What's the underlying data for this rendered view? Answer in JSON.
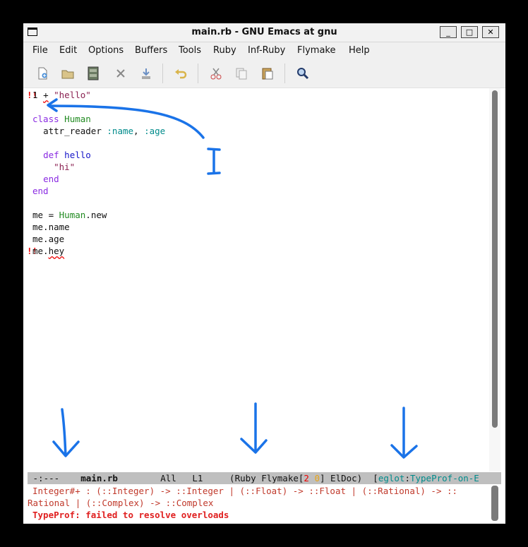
{
  "window": {
    "title": "main.rb - GNU Emacs at gnu",
    "minimize_label": "_",
    "maximize_label": "□",
    "close_label": "✕"
  },
  "menubar": [
    "File",
    "Edit",
    "Options",
    "Buffers",
    "Tools",
    "Ruby",
    "Inf-Ruby",
    "Flymake",
    "Help"
  ],
  "toolbar": {
    "icons": [
      "new-file-icon",
      "open-folder-icon",
      "save-icon",
      "close-icon",
      "save-as-icon",
      "undo-icon",
      "cut-icon",
      "copy-icon",
      "paste-icon",
      "search-icon"
    ]
  },
  "editor": {
    "bang": "!!",
    "l1_num": "1",
    "l1_plus": "+",
    "l1_str": "\"hello\"",
    "l2_kw": "class",
    "l2_const": "Human",
    "l3_method": "attr_reader",
    "l3_sym1": ":name",
    "l3_comma": ",",
    "l3_sym2": ":age",
    "l4_kw": "def",
    "l4_fn": "hello",
    "l5_str": "\"hi\"",
    "l6_kw": "end",
    "l7_kw": "end",
    "l8_var": "me",
    "l8_eq": "=",
    "l8_const": "Human",
    "l8_call": ".new",
    "l9": "me.name",
    "l10": "me.age",
    "l11_recv": "me.",
    "l11_call": "hey"
  },
  "modeline": {
    "status": "-:---",
    "buffer": "main.rb",
    "position": "All",
    "line": "L1",
    "mode_prefix": "(Ruby Flymake[",
    "errors": "2",
    "warnings": "0",
    "mode_suffix": "] ElDoc)",
    "eglot_open": "[",
    "eglot": "eglot",
    "eglot_sep": ":",
    "server": "TypeProf-on-E"
  },
  "echo": {
    "line1": "Integer#+ : (::Integer) -> ::Integer | (::Float) -> ::Float | (::Rational) -> ::",
    "line2": "Rational | (::Complex) -> ::Complex",
    "line3": "TypeProf: failed to resolve overloads"
  },
  "colors": {
    "annotation": "#1a73e8",
    "error": "#e00000",
    "keyword": "#8a2be2",
    "constant": "#228b22"
  }
}
